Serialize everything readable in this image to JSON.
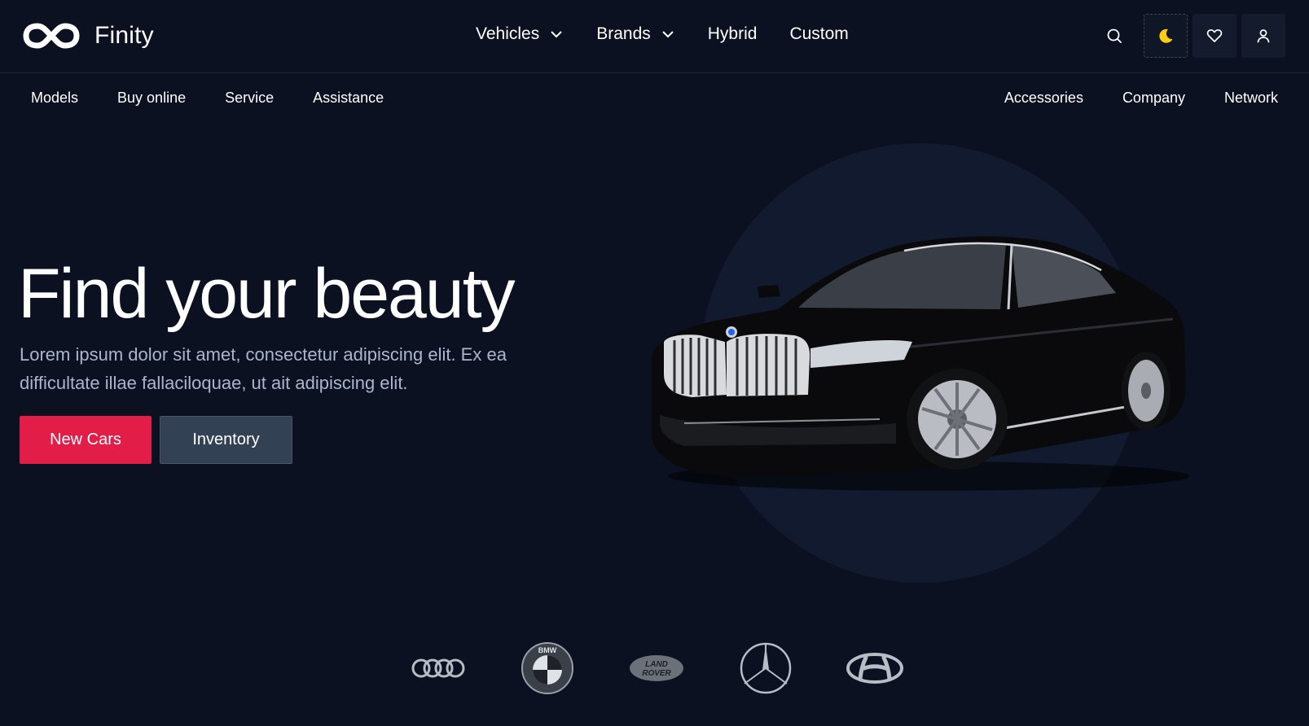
{
  "brand": {
    "name": "Finity",
    "logo_icon": "infinity-logo-icon"
  },
  "main_nav": [
    {
      "label": "Vehicles",
      "has_dropdown": true
    },
    {
      "label": "Brands",
      "has_dropdown": true
    },
    {
      "label": "Hybrid",
      "has_dropdown": false
    },
    {
      "label": "Custom",
      "has_dropdown": false
    }
  ],
  "header_icons": [
    "search-icon",
    "moon-icon",
    "heart-icon",
    "user-icon"
  ],
  "sub_nav": {
    "left": [
      "Models",
      "Buy online",
      "Service",
      "Assistance"
    ],
    "right": [
      "Accessories",
      "Company",
      "Network"
    ]
  },
  "hero": {
    "title": "Find your beauty",
    "text": "Lorem ipsum dolor sit amet, consectetur adipiscing elit. Ex ea difficultate illae fallaciloquae, ut ait adipiscing elit.",
    "primary_button": "New Cars",
    "secondary_button": "Inventory"
  },
  "brands": [
    "audi-logo",
    "bmw-logo",
    "land-rover-logo",
    "mercedes-logo",
    "hyundai-logo"
  ],
  "brand_text": {
    "bmw": "BMW",
    "land_rover_line1": "LAND",
    "land_rover_line2": "ROVER"
  },
  "colors": {
    "background": "#0b1120",
    "accent": "#e11d48",
    "secondary_button": "#334155",
    "moon": "#facc15",
    "muted_text": "#a9b6cc"
  }
}
